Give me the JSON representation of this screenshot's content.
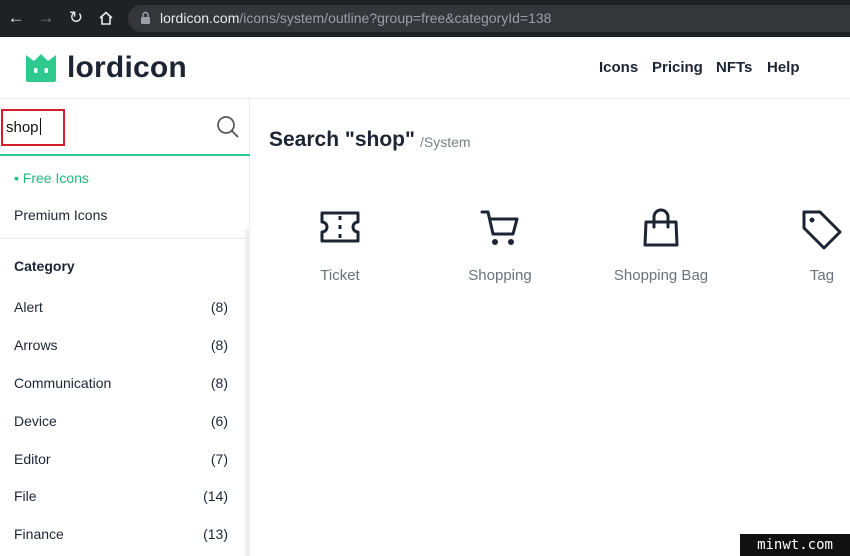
{
  "browser": {
    "url_host": "lordicon.com",
    "url_path": "/icons/system/outline?group=free&categoryId=138"
  },
  "site": {
    "logo_text": "lordicon",
    "nav": [
      "Icons",
      "Pricing",
      "NFTs",
      "Help"
    ]
  },
  "sidebar": {
    "search_value": "shop",
    "free_label": "Free Icons",
    "premium_label": "Premium Icons",
    "category_title": "Category",
    "categories": [
      {
        "name": "Alert",
        "count": "(8)"
      },
      {
        "name": "Arrows",
        "count": "(8)"
      },
      {
        "name": "Communication",
        "count": "(8)"
      },
      {
        "name": "Device",
        "count": "(6)"
      },
      {
        "name": "Editor",
        "count": "(7)"
      },
      {
        "name": "File",
        "count": "(14)"
      },
      {
        "name": "Finance",
        "count": "(13)"
      }
    ]
  },
  "main": {
    "title": "Search \"shop\"",
    "path": "/System",
    "results": [
      {
        "label": "Ticket",
        "icon": "ticket-icon"
      },
      {
        "label": "Shopping",
        "icon": "shopping-cart-icon"
      },
      {
        "label": "Shopping Bag",
        "icon": "shopping-bag-icon"
      },
      {
        "label": "Tag",
        "icon": "tag-icon"
      }
    ]
  },
  "watermark": "minwt.com",
  "colors": {
    "accent": "#2ec98f",
    "highlight_border": "#d21f2a",
    "text_dark": "#1d2433"
  }
}
